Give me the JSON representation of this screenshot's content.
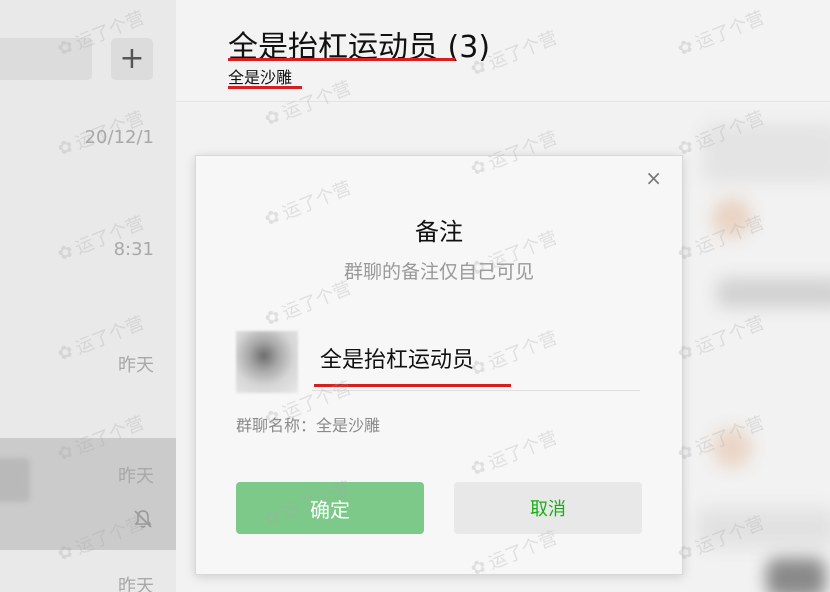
{
  "sidebar": {
    "add_label": "+",
    "items": [
      {
        "time": "20/12/1"
      },
      {
        "time": "8:31"
      },
      {
        "time": "昨天"
      },
      {
        "time": "昨天"
      },
      {
        "time": "昨天"
      }
    ]
  },
  "header": {
    "title": "全是抬杠运动员 (3)",
    "subtitle": "全是沙雕"
  },
  "dialog": {
    "title": "备注",
    "description": "群聊的备注仅自己可见",
    "remark_value": "全是抬杠运动员",
    "group_name_hint": "群聊名称：全是沙雕",
    "ok_label": "确定",
    "cancel_label": "取消",
    "close_icon": "×"
  },
  "watermark": {
    "text": "运了个营",
    "icon": "wechat-icon"
  },
  "colors": {
    "ok_button": "#7cc98a",
    "cancel_text": "#1aad19",
    "annotation_red": "#d42020"
  }
}
